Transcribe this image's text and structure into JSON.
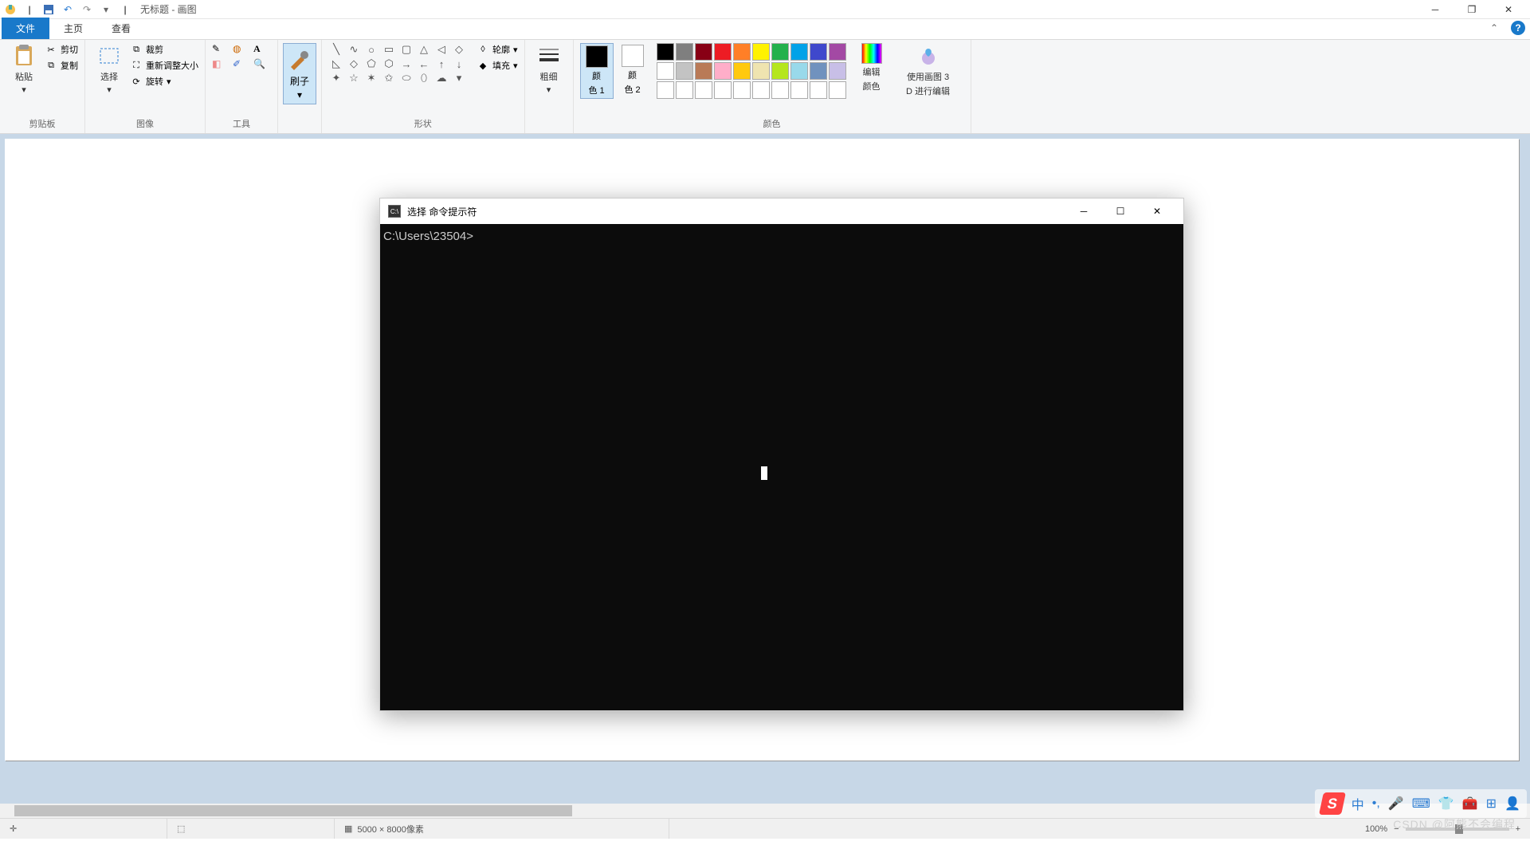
{
  "titlebar": {
    "untitled": "无标题 - 画图",
    "qat_sep": "|"
  },
  "tabs": {
    "file": "文件",
    "home": "主页",
    "view": "查看"
  },
  "ribbon": {
    "clipboard": {
      "paste": "粘贴",
      "cut": "剪切",
      "copy": "复制",
      "label": "剪贴板"
    },
    "image": {
      "select": "选择",
      "crop": "裁剪",
      "resize": "重新调整大小",
      "rotate": "旋转",
      "label": "图像"
    },
    "tools": {
      "label": "工具"
    },
    "brush": {
      "label": "刷子"
    },
    "shapes": {
      "outline": "轮廓",
      "fill": "填充",
      "label": "形状"
    },
    "stroke": {
      "label": "粗细"
    },
    "color1": {
      "label_l1": "颜",
      "label_l2": "色 1"
    },
    "color2": {
      "label_l1": "颜",
      "label_l2": "色 2"
    },
    "edit_colors": {
      "l1": "编辑",
      "l2": "颜色"
    },
    "paint3d": {
      "l1": "使用画图 3",
      "l2": "D 进行编辑"
    },
    "colors_label": "颜色",
    "palette_row1": [
      "#000000",
      "#7f7f7f",
      "#880015",
      "#ed1c24",
      "#ff7f27",
      "#fff200",
      "#22b14c",
      "#00a2e8",
      "#3f48cc",
      "#a349a4"
    ],
    "palette_row2": [
      "#ffffff",
      "#c3c3c3",
      "#b97a57",
      "#ffaec9",
      "#ffc90e",
      "#efe4b0",
      "#b5e61d",
      "#99d9ea",
      "#7092be",
      "#c8bfe7"
    ],
    "palette_row3": [
      "#ffffff",
      "#ffffff",
      "#ffffff",
      "#ffffff",
      "#ffffff",
      "#ffffff",
      "#ffffff",
      "#ffffff",
      "#ffffff",
      "#ffffff"
    ],
    "color1_value": "#000000",
    "color2_value": "#ffffff",
    "rainbow": "linear-gradient(90deg,#f00,#ff0,#0f0,#0ff,#00f,#f0f)"
  },
  "cmd": {
    "title": "选择 命令提示符",
    "prompt": "C:\\Users\\23504>"
  },
  "statusbar": {
    "dims": "5000 × 8000像素",
    "zoom": "100%"
  },
  "ime": {
    "lang": "中"
  },
  "watermark": "CSDN @阿熊不会编程"
}
